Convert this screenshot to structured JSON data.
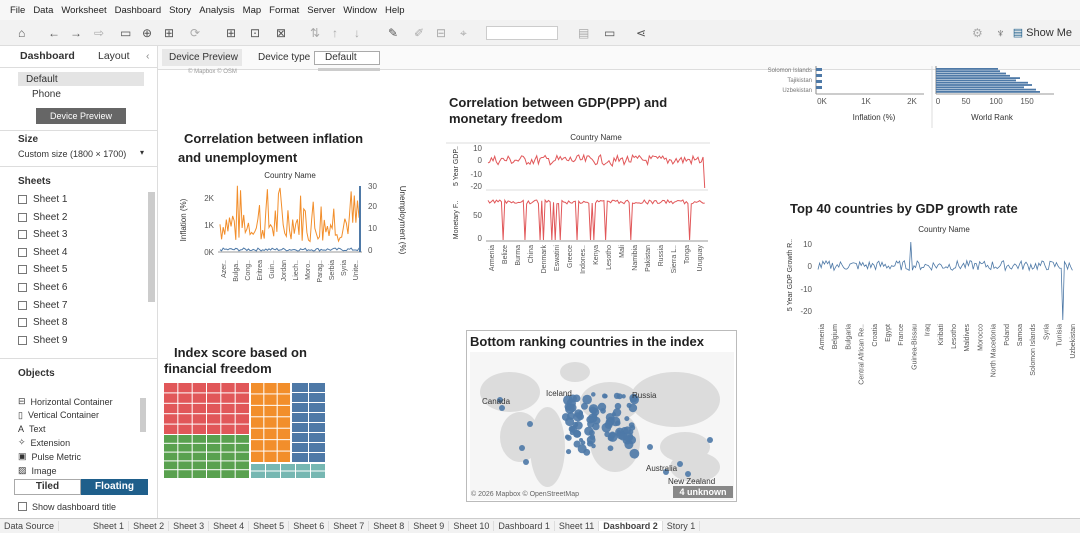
{
  "menu": [
    "File",
    "Data",
    "Worksheet",
    "Dashboard",
    "Story",
    "Analysis",
    "Map",
    "Format",
    "Server",
    "Window",
    "Help"
  ],
  "toolbar": {
    "show_me": "Show Me"
  },
  "sidebar": {
    "tab_dashboard": "Dashboard",
    "tab_layout": "Layout",
    "device_default": "Default",
    "device_phone": "Phone",
    "device_preview_btn": "Device Preview",
    "size_heading": "Size",
    "size_value": "Custom size (1800 × 1700)",
    "sheets_heading": "Sheets",
    "sheets": [
      "Sheet 1",
      "Sheet 2",
      "Sheet 3",
      "Sheet 4",
      "Sheet 5",
      "Sheet 6",
      "Sheet 7",
      "Sheet 8",
      "Sheet 9"
    ],
    "objects_heading": "Objects",
    "objects": [
      {
        "icon": "horizontal-container-icon",
        "glyph": "⊟",
        "label": "Horizontal Container"
      },
      {
        "icon": "vertical-container-icon",
        "glyph": "▯",
        "label": "Vertical Container"
      },
      {
        "icon": "text-icon",
        "glyph": "A",
        "label": "Text"
      },
      {
        "icon": "extension-icon",
        "glyph": "✧",
        "label": "Extension"
      },
      {
        "icon": "pulse-metric-icon",
        "glyph": "▣",
        "label": "Pulse Metric"
      },
      {
        "icon": "image-icon",
        "glyph": "▨",
        "label": "Image"
      }
    ],
    "tiled": "Tiled",
    "floating": "Floating",
    "show_title": "Show dashboard title"
  },
  "canvas_top": {
    "device_preview": "Device Preview",
    "device_type_label": "Device type",
    "device_type_value": "Default",
    "mapbox_top": "© Mapbox © OSM"
  },
  "charts": {
    "inflation": {
      "title_line1": "Correlation between inflation",
      "title_line2": "and unemployment",
      "header": "Country Name",
      "ylabel": "Inflation (%)",
      "y2label": "Unemployment (%)",
      "yticks": [
        "2K",
        "1K",
        "0K"
      ],
      "y2ticks": [
        "30",
        "20",
        "10",
        "0"
      ],
      "xlabels": [
        "Azer..",
        "Bulga..",
        "Cong..",
        "Eritrea",
        "Guin..",
        "Jordan",
        "Liech..",
        "Moro..",
        "Parag..",
        "Serbia",
        "Syria",
        "Unite.."
      ]
    },
    "gdp_mon": {
      "title_line1": "Correlation between GDP(PPP) and",
      "title_line2": "monetary freedom",
      "header": "Country Name",
      "ylabel1": "5 Year GDP..",
      "ylabel2": "Monetary F..",
      "yticks1": [
        "10",
        "0",
        "-10",
        "-20"
      ],
      "yticks2": [
        "50",
        "0"
      ],
      "xlabels": [
        "Armenia",
        "Belize",
        "Burma",
        "China",
        "Denmark",
        "Eswatini",
        "Greece",
        "Indones..",
        "Kenya",
        "Lesotho",
        "Mali",
        "Namibia",
        "Pakistan",
        "Russia",
        "Sierra L..",
        "Tonga",
        "Uruguay"
      ]
    },
    "top_right": {
      "xticks1": [
        "0K",
        "1K",
        "2K"
      ],
      "xlabel1": "Inflation (%)",
      "xticks2": [
        "0",
        "50",
        "100",
        "150"
      ],
      "xlabel2": "World Rank",
      "cut_labels": [
        "Solomon Islands",
        "Tajikistan",
        "Uzbekistan"
      ]
    },
    "top40": {
      "title": "Top 40 countries by GDP growth rate",
      "header": "Country Name",
      "ylabel": "5 Year GDP Growth R..",
      "yticks": [
        "10",
        "0",
        "-10",
        "-20"
      ],
      "xlabels": [
        "Armenia",
        "Belgium",
        "Bulgaria",
        "Central African Re..",
        "Croatia",
        "Egypt",
        "France",
        "Guinea-Bissau",
        "Iraq",
        "Kiribati",
        "Lesotho",
        "Maldives",
        "Morocco",
        "North Macedonia",
        "Poland",
        "Samoa",
        "Solomon Islands",
        "Syria",
        "Tunisia",
        "Uzbekistan"
      ]
    },
    "treemap": {
      "title_line1": "Index score based on",
      "title_line2": "financial freedom"
    },
    "map": {
      "title": "Bottom ranking countries in the index",
      "labels": {
        "canada": "Canada",
        "iceland": "Iceland",
        "russia": "Russia",
        "australia": "Australia",
        "nz": "New Zealand"
      },
      "unknown": "4 unknown",
      "copyright": "© 2026 Mapbox © OpenStreetMap"
    }
  },
  "bottom_tabs": [
    {
      "label": "Data Source",
      "active": false
    },
    {
      "label": "Sheet 1",
      "active": false
    },
    {
      "label": "Sheet 2",
      "active": false
    },
    {
      "label": "Sheet 3",
      "active": false
    },
    {
      "label": "Sheet 4",
      "active": false
    },
    {
      "label": "Sheet 5",
      "active": false
    },
    {
      "label": "Sheet 6",
      "active": false
    },
    {
      "label": "Sheet 7",
      "active": false
    },
    {
      "label": "Sheet 8",
      "active": false
    },
    {
      "label": "Sheet 9",
      "active": false
    },
    {
      "label": "Sheet 10",
      "active": false
    },
    {
      "label": "Dashboard 1",
      "active": false
    },
    {
      "label": "Sheet 11",
      "active": false
    },
    {
      "label": "Dashboard 2",
      "active": true
    },
    {
      "label": "Story 1",
      "active": false
    }
  ],
  "colors": {
    "orange": "#f28e2b",
    "blue": "#4e79a7",
    "red": "#e15759",
    "green": "#59a14f",
    "teal": "#76b7b2",
    "accent": "#1f5f8b"
  }
}
